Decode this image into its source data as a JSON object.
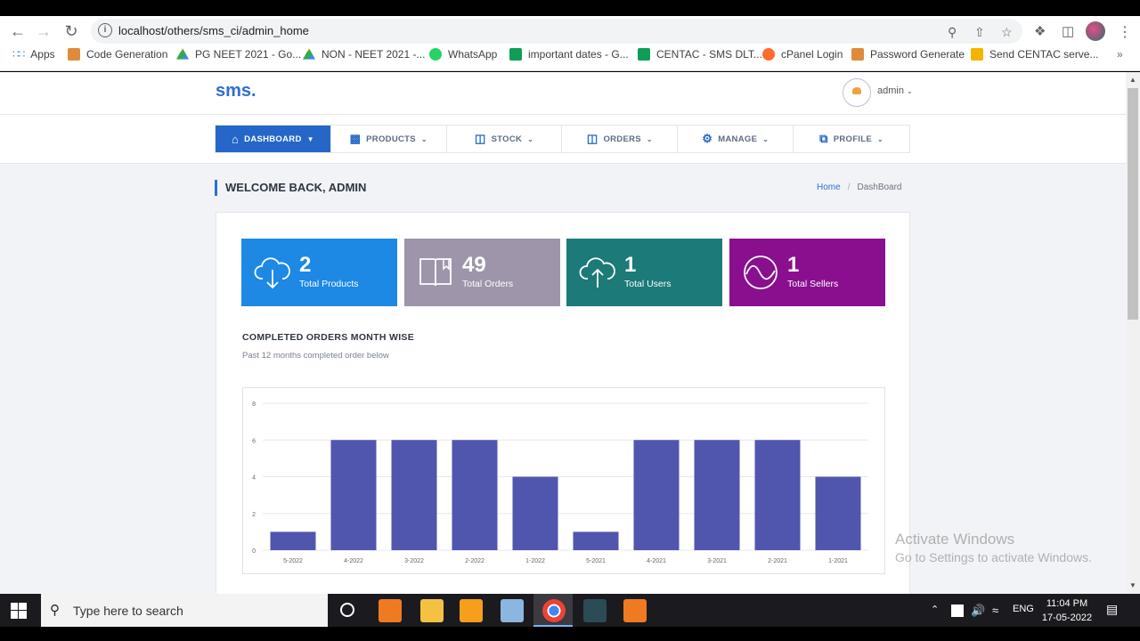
{
  "browser": {
    "url": "localhost/others/sms_ci/admin_home",
    "bookmarks": [
      {
        "label": "Apps",
        "color": "#4285f4"
      },
      {
        "label": "Code Generation",
        "color": "#e08a3c"
      },
      {
        "label": "PG NEET 2021 - Go...",
        "color": "#1fa463"
      },
      {
        "label": "NON - NEET 2021 -...",
        "color": "#1fa463"
      },
      {
        "label": "WhatsApp",
        "color": "#25d366"
      },
      {
        "label": "important dates - G...",
        "color": "#0f9d58"
      },
      {
        "label": "CENTAC - SMS DLT...",
        "color": "#0f9d58"
      },
      {
        "label": "cPanel Login",
        "color": "#ff6c2c"
      },
      {
        "label": "Password Generate",
        "color": "#e08a3c"
      },
      {
        "label": "Send CENTAC serve...",
        "color": "#f4b400"
      }
    ]
  },
  "app": {
    "logo": "sms.",
    "user": "admin",
    "menu": [
      {
        "label": "DASHBOARD",
        "icon": "home-icon"
      },
      {
        "label": "PRODUCTS",
        "icon": "trash-icon"
      },
      {
        "label": "STOCK",
        "icon": "map-icon"
      },
      {
        "label": "ORDERS",
        "icon": "book-icon"
      },
      {
        "label": "MANAGE",
        "icon": "gear-icon"
      },
      {
        "label": "PROFILE",
        "icon": "window-icon"
      }
    ],
    "welcome": "WELCOME BACK, ADMIN",
    "breadcrumb": {
      "home": "Home",
      "sep": "/",
      "current": "DashBoard"
    }
  },
  "stats": [
    {
      "value": "2",
      "label": "Total Products",
      "color": "#1e88e5",
      "icon": "cloud-download-icon"
    },
    {
      "value": "49",
      "label": "Total Orders",
      "color": "#9e95aa",
      "icon": "book-open-icon"
    },
    {
      "value": "1",
      "label": "Total Users",
      "color": "#1c7a78",
      "icon": "cloud-upload-icon"
    },
    {
      "value": "1",
      "label": "Total Sellers",
      "color": "#8a0f8e",
      "icon": "wave-icon"
    }
  ],
  "section": {
    "title": "COMPLETED ORDERS MONTH WISE",
    "subtitle": "Past 12 months completed order below"
  },
  "chart_data": {
    "type": "bar",
    "categories": [
      "5-2022",
      "4-2022",
      "3-2022",
      "2-2022",
      "1-2022",
      "5-2021",
      "4-2021",
      "3-2021",
      "2-2021",
      "1-2021"
    ],
    "values": [
      1,
      6,
      6,
      6,
      4,
      1,
      6,
      6,
      6,
      4
    ],
    "yticks": [
      0,
      2,
      4,
      6,
      8
    ],
    "ylim": [
      0,
      8
    ],
    "bar_color": "#5056ad",
    "grid": true
  },
  "watermark": {
    "line1": "Activate Windows",
    "line2": "Go to Settings to activate Windows."
  },
  "taskbar": {
    "search_placeholder": "Type here to search",
    "lang": "ENG",
    "time": "11:04 PM",
    "date": "17-05-2022"
  }
}
